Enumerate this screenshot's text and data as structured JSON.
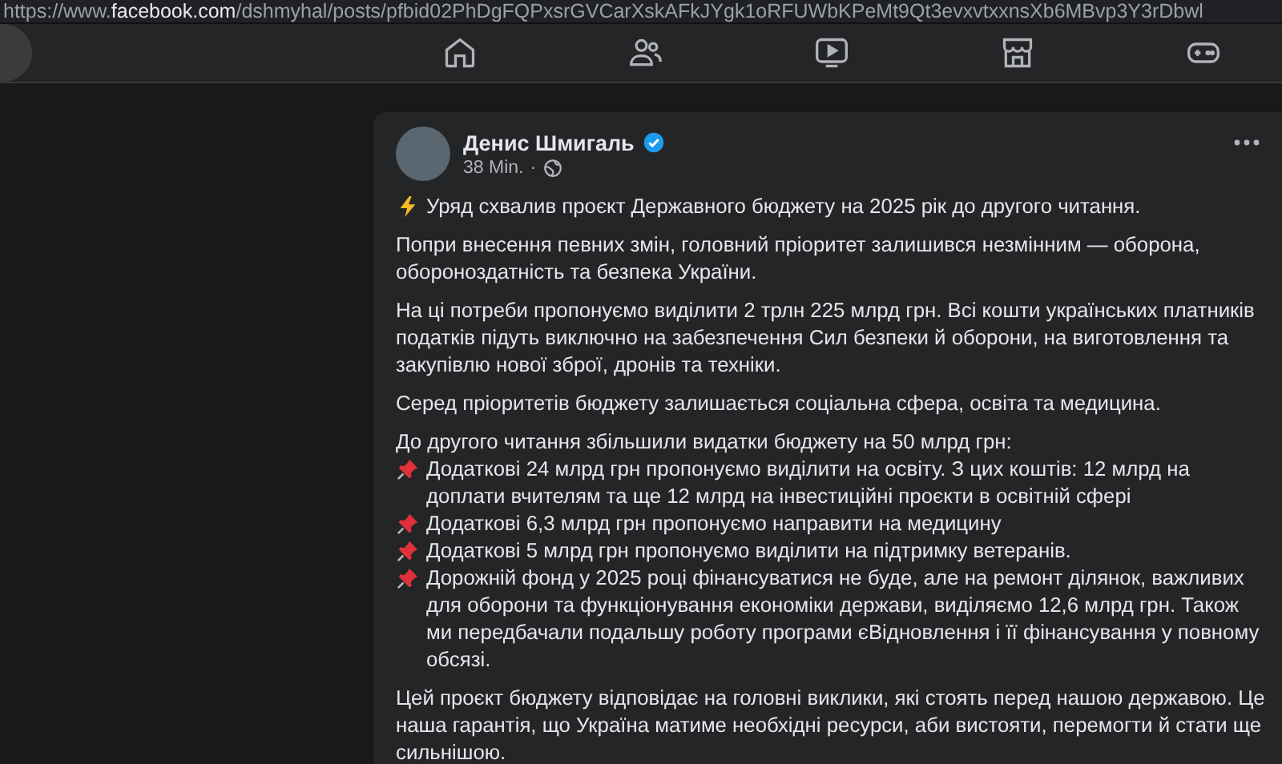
{
  "url": {
    "scheme": "https://www.",
    "domain": "facebook.com",
    "path": "/dshmyhal/posts/pfbid02PhDgFQPxsrGVCarXskAFkJYgk1oRFUWbKPeMt9Qt3evxvtxxnsXb6MBvp3Y3rDbwl"
  },
  "nav": [
    {
      "kind": "home"
    },
    {
      "kind": "friends"
    },
    {
      "kind": "video"
    },
    {
      "kind": "marketplace"
    },
    {
      "kind": "gaming"
    }
  ],
  "post": {
    "author": "Денис Шмигаль",
    "verified": true,
    "time": "38 Min.",
    "separator": "·",
    "paragraphs": [
      [
        {
          "kind": "lightning",
          "text": "Уряд схвалив проєкт Державного бюджету на 2025 рік до другого читання."
        }
      ],
      [
        {
          "kind": "plain",
          "text": "Попри внесення певних змін, головний пріоритет залишився незмінним — оборона, обороноздатність та безпека України."
        }
      ],
      [
        {
          "kind": "plain",
          "text": "На ці потреби пропонуємо виділити 2 трлн 225 млрд грн. Всі кошти українських платників податків підуть виключно на забезпечення Сил безпеки й оборони, на виготовлення та закупівлю нової зброї, дронів та техніки."
        }
      ],
      [
        {
          "kind": "plain",
          "text": "Серед пріоритетів бюджету залишається соціальна сфера, освіта та медицина."
        }
      ],
      [
        {
          "kind": "plain",
          "text": "До другого читання збільшили видатки бюджету на 50 млрд грн:"
        },
        {
          "kind": "pin",
          "text": "Додаткові 24 млрд грн пропонуємо виділити на освіту. З цих коштів: 12 млрд на доплати вчителям та ще 12 млрд на інвестиційні проєкти в освітній сфері"
        },
        {
          "kind": "pin",
          "text": "Додаткові 6,3 млрд грн пропонуємо направити на медицину"
        },
        {
          "kind": "pin",
          "text": "Додаткові 5 млрд грн пропонуємо виділити на підтримку ветеранів."
        },
        {
          "kind": "pin",
          "text": "Дорожній фонд у 2025 році фінансуватися не буде, але на ремонт ділянок, важливих для оборони та функціонування економіки держави, виділяємо 12,6 млрд грн. Також ми передбачали подальшу роботу програми єВідновлення і її фінансування у повному обсязі."
        }
      ],
      [
        {
          "kind": "plain",
          "text": "Цей проєкт бюджету відповідає на головні виклики, які стоять перед нашою державою. Це наша гарантія, що Україна матиме необхідні ресурси, аби вистояти, перемогти й стати ще сильнішою."
        }
      ]
    ]
  }
}
